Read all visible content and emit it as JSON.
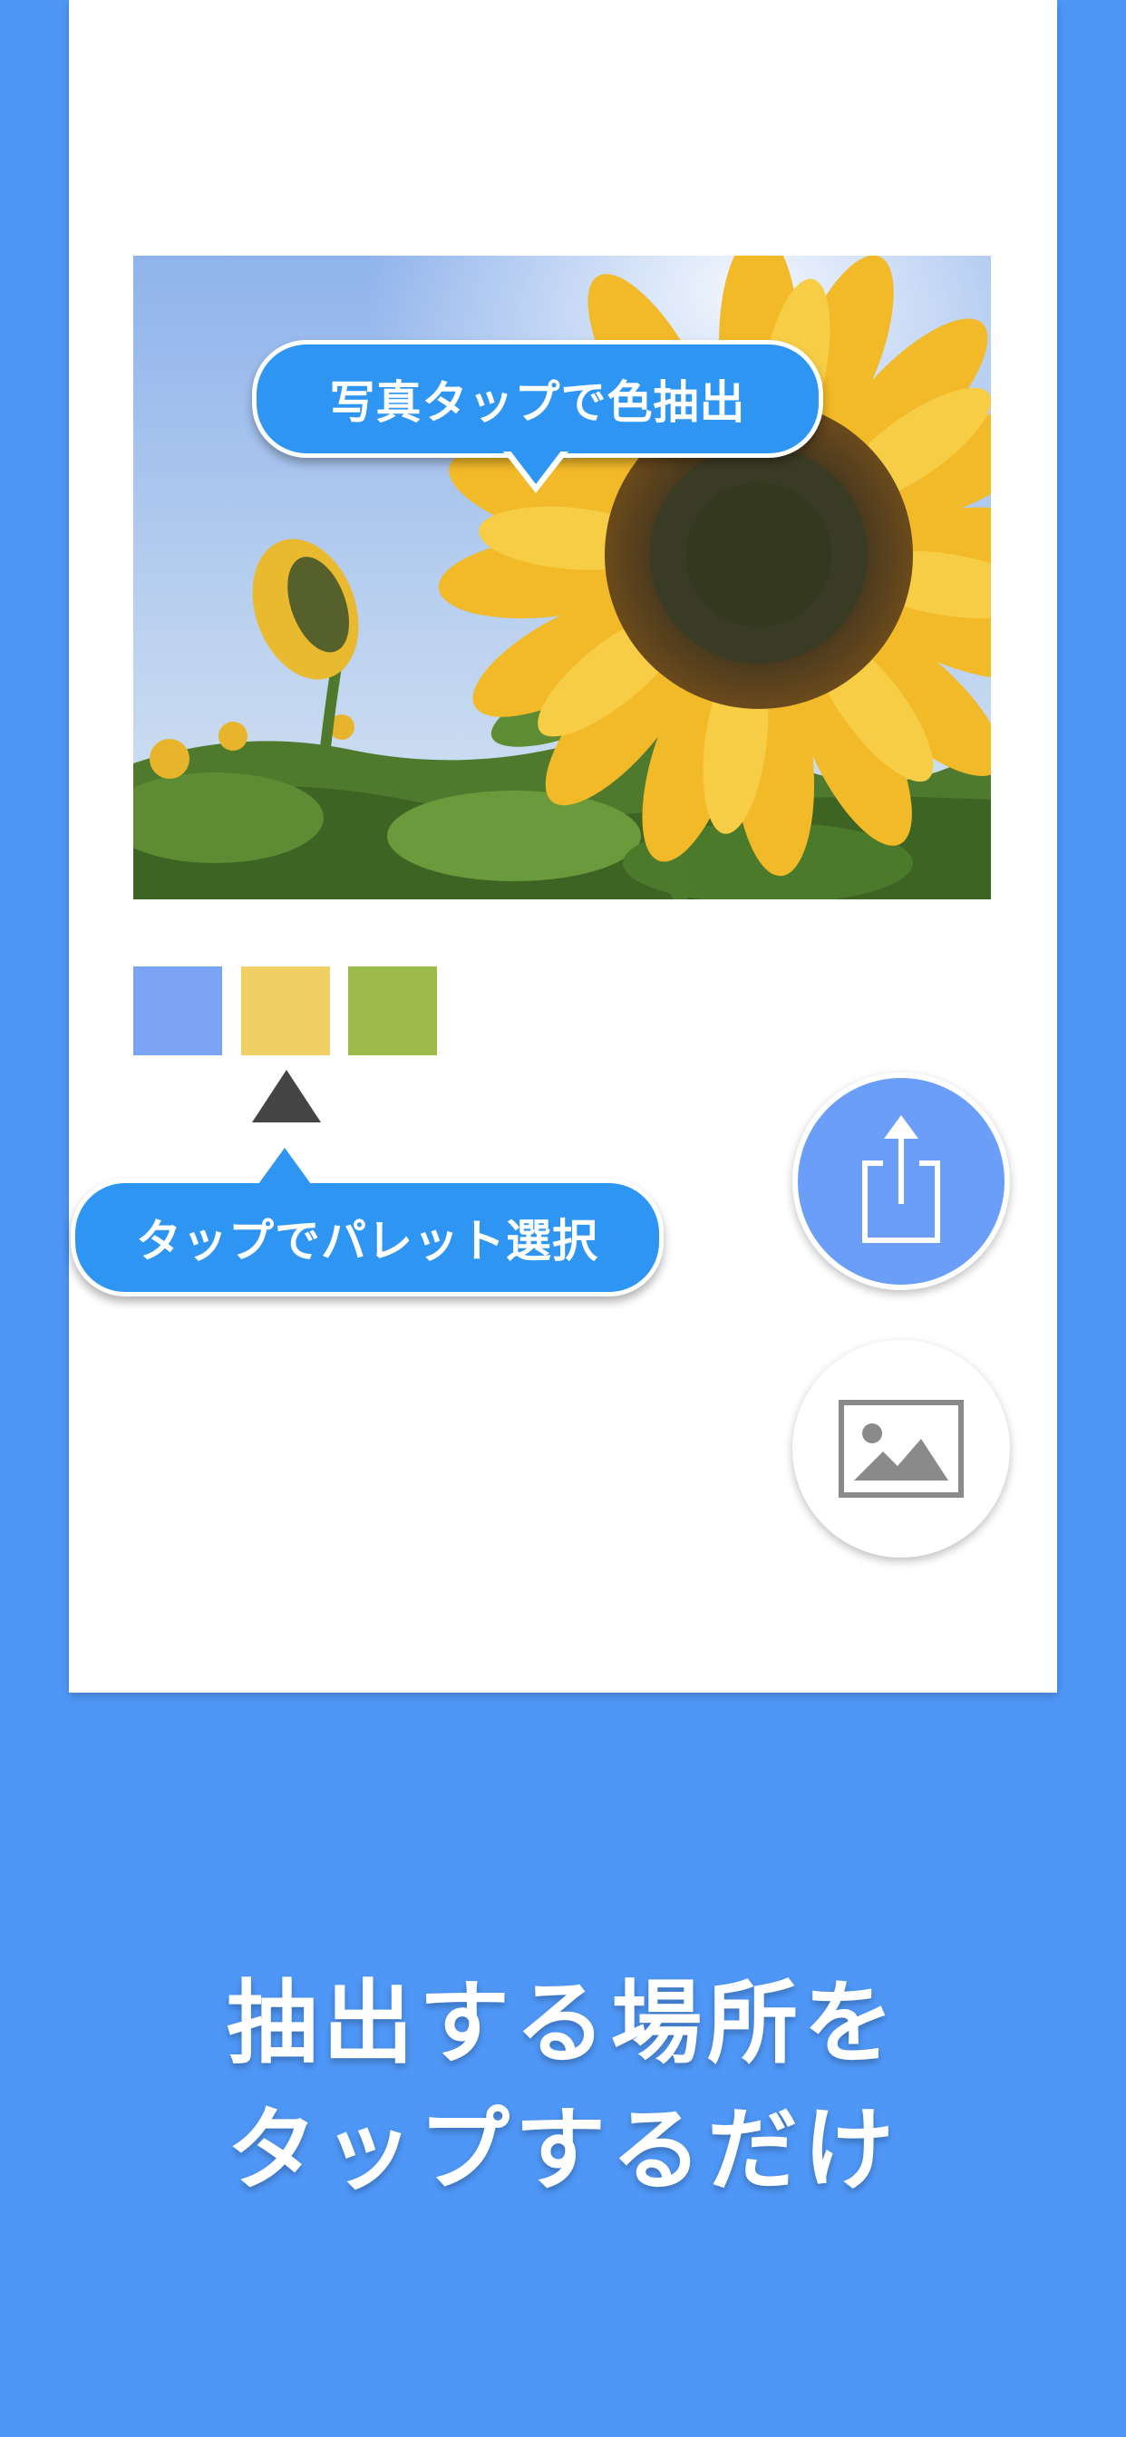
{
  "photo": {
    "subject": "sunflower field under blue sky"
  },
  "bubbles": {
    "photo_tap_label": "写真タップで色抽出",
    "palette_select_label": "タップでパレット選択"
  },
  "palette": {
    "swatches": [
      {
        "color": "#7aa3f3"
      },
      {
        "color": "#f0cf65"
      },
      {
        "color": "#9cbb4a"
      }
    ]
  },
  "buttons": {
    "share_icon": "share-icon",
    "image_icon": "image-icon"
  },
  "caption": {
    "line1": "抽出する場所を",
    "line2": "タップするだけ"
  },
  "colors": {
    "background": "#4f97f7",
    "bubble": "#2e95f3",
    "share_button": "#6a9ef8"
  }
}
